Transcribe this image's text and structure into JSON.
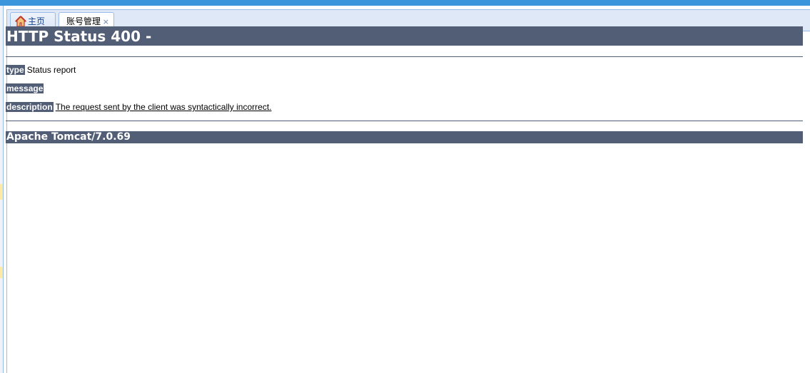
{
  "tabs": [
    {
      "label": "主页",
      "icon": "home-icon"
    },
    {
      "label": "账号管理",
      "close_symbol": "×"
    }
  ],
  "error_page": {
    "title": "HTTP Status 400 -",
    "type_label": "type",
    "type_value": "Status report",
    "message_label": "message",
    "message_value": "",
    "description_label": "description",
    "description_value": "The request sent by the client was syntactically incorrect.",
    "server": "Apache Tomcat/7.0.69"
  },
  "colors": {
    "top_bar": "#3b96db",
    "heading_bg": "#525d76",
    "tab_border": "#99bbe8"
  }
}
